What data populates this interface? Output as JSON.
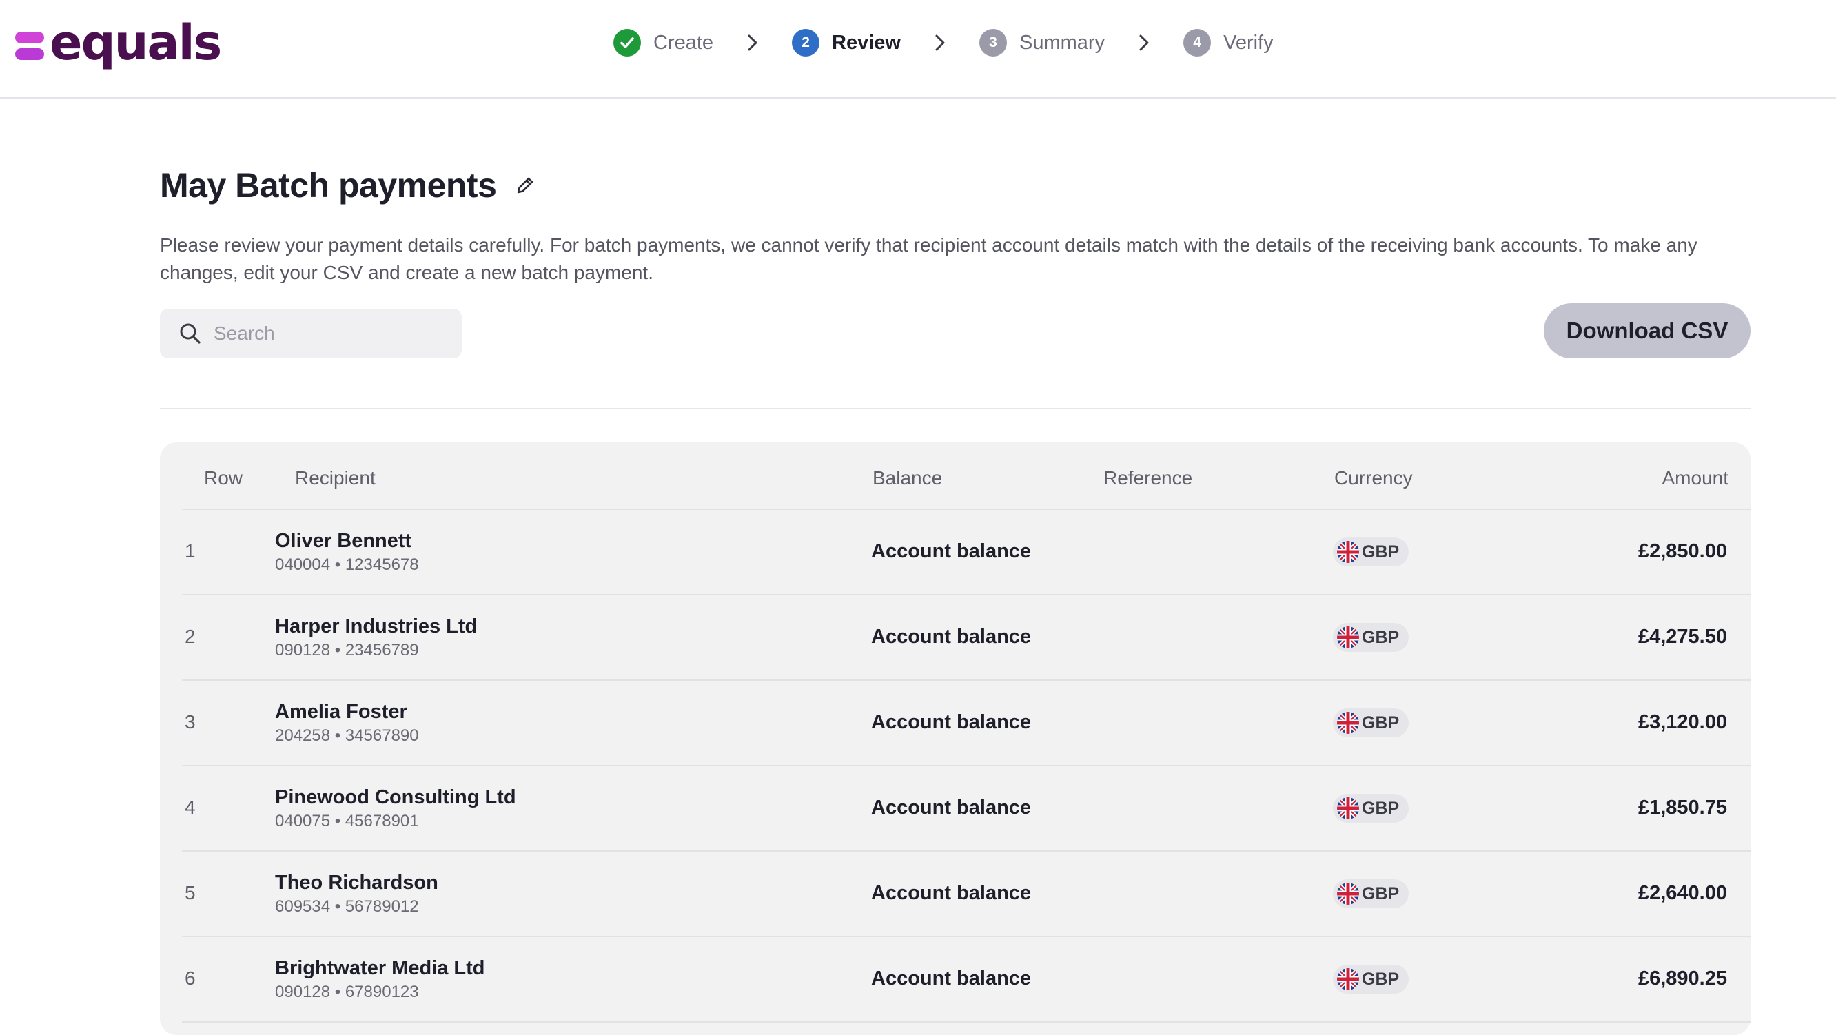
{
  "brand": {
    "name": "equals"
  },
  "stepper": {
    "steps": [
      {
        "number": "1",
        "label": "Create",
        "state": "done"
      },
      {
        "number": "2",
        "label": "Review",
        "state": "active"
      },
      {
        "number": "3",
        "label": "Summary",
        "state": "pending"
      },
      {
        "number": "4",
        "label": "Verify",
        "state": "pending"
      }
    ]
  },
  "page": {
    "title": "May Batch payments",
    "description": "Please review your payment details carefully. For batch payments, we cannot verify that recipient account details match with the details of the receiving bank accounts. To make any changes, edit your CSV and create a new batch payment."
  },
  "search": {
    "placeholder": "Search",
    "value": ""
  },
  "actions": {
    "download_csv": "Download CSV"
  },
  "table": {
    "headers": {
      "row": "Row",
      "recipient": "Recipient",
      "balance": "Balance",
      "reference": "Reference",
      "currency": "Currency",
      "amount": "Amount"
    },
    "rows": [
      {
        "row": "1",
        "name": "Oliver Bennett",
        "account": "040004 • 12345678",
        "balance": "Account balance",
        "reference": "",
        "currency": "GBP",
        "amount": "£2,850.00"
      },
      {
        "row": "2",
        "name": "Harper Industries Ltd",
        "account": "090128 • 23456789",
        "balance": "Account balance",
        "reference": "",
        "currency": "GBP",
        "amount": "£4,275.50"
      },
      {
        "row": "3",
        "name": "Amelia Foster",
        "account": "204258 • 34567890",
        "balance": "Account balance",
        "reference": "",
        "currency": "GBP",
        "amount": "£3,120.00"
      },
      {
        "row": "4",
        "name": "Pinewood Consulting Ltd",
        "account": "040075 • 45678901",
        "balance": "Account balance",
        "reference": "",
        "currency": "GBP",
        "amount": "£1,850.75"
      },
      {
        "row": "5",
        "name": "Theo Richardson",
        "account": "609534 • 56789012",
        "balance": "Account balance",
        "reference": "",
        "currency": "GBP",
        "amount": "£2,640.00"
      },
      {
        "row": "6",
        "name": "Brightwater Media Ltd",
        "account": "090128 • 67890123",
        "balance": "Account balance",
        "reference": "",
        "currency": "GBP",
        "amount": "£6,890.25"
      }
    ]
  },
  "colors": {
    "brand_text": "#4a0f4f",
    "brand_mark": "#c73bd6",
    "step_done": "#1f9a3a",
    "step_active": "#2f6ec6",
    "step_pending": "#9a9aa8",
    "button_bg": "#c3c3d0",
    "table_bg": "#f2f2f3"
  },
  "icons": {
    "logo": "equals-logo-icon",
    "step_done": "check-circle-icon",
    "separator": "chevron-right-icon",
    "edit": "pencil-icon",
    "search": "search-icon",
    "currency_flag": "uk-flag-icon"
  }
}
